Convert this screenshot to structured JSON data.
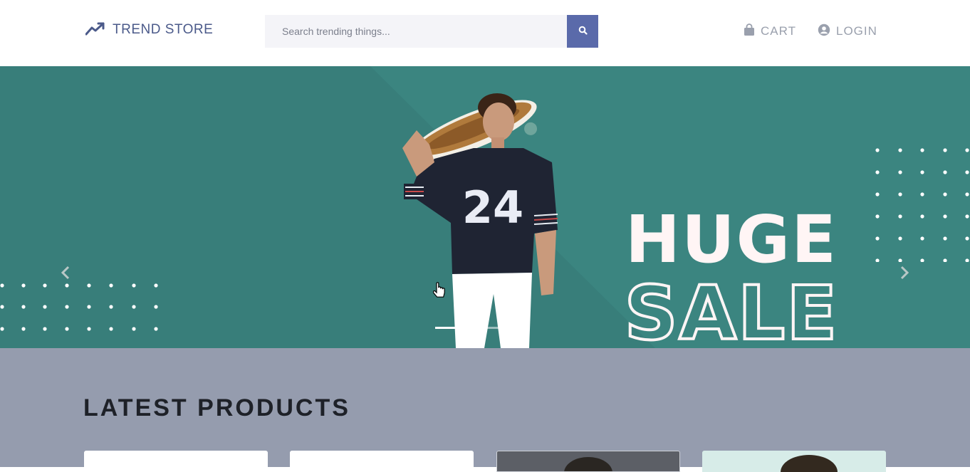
{
  "header": {
    "brand": "TREND STORE",
    "search_placeholder": "Search trending things...",
    "cart_label": "CART",
    "login_label": "LOGIN"
  },
  "hero": {
    "headline_1": "HUGE",
    "headline_2": "SALE",
    "jersey_number": "24",
    "slide_count": 3,
    "active_slide": 1,
    "background_color": "#387e7a"
  },
  "products": {
    "title": "LATEST PRODUCTS"
  },
  "colors": {
    "brand": "#4b5a8a",
    "search_button": "#5a6aaa",
    "section_bg": "#959cae"
  },
  "icons": {
    "brand_icon": "trending-up-icon",
    "search_icon": "search-icon",
    "cart_icon": "shopping-bag-icon",
    "login_icon": "user-circle-icon",
    "prev_icon": "chevron-left-icon",
    "next_icon": "chevron-right-icon"
  }
}
